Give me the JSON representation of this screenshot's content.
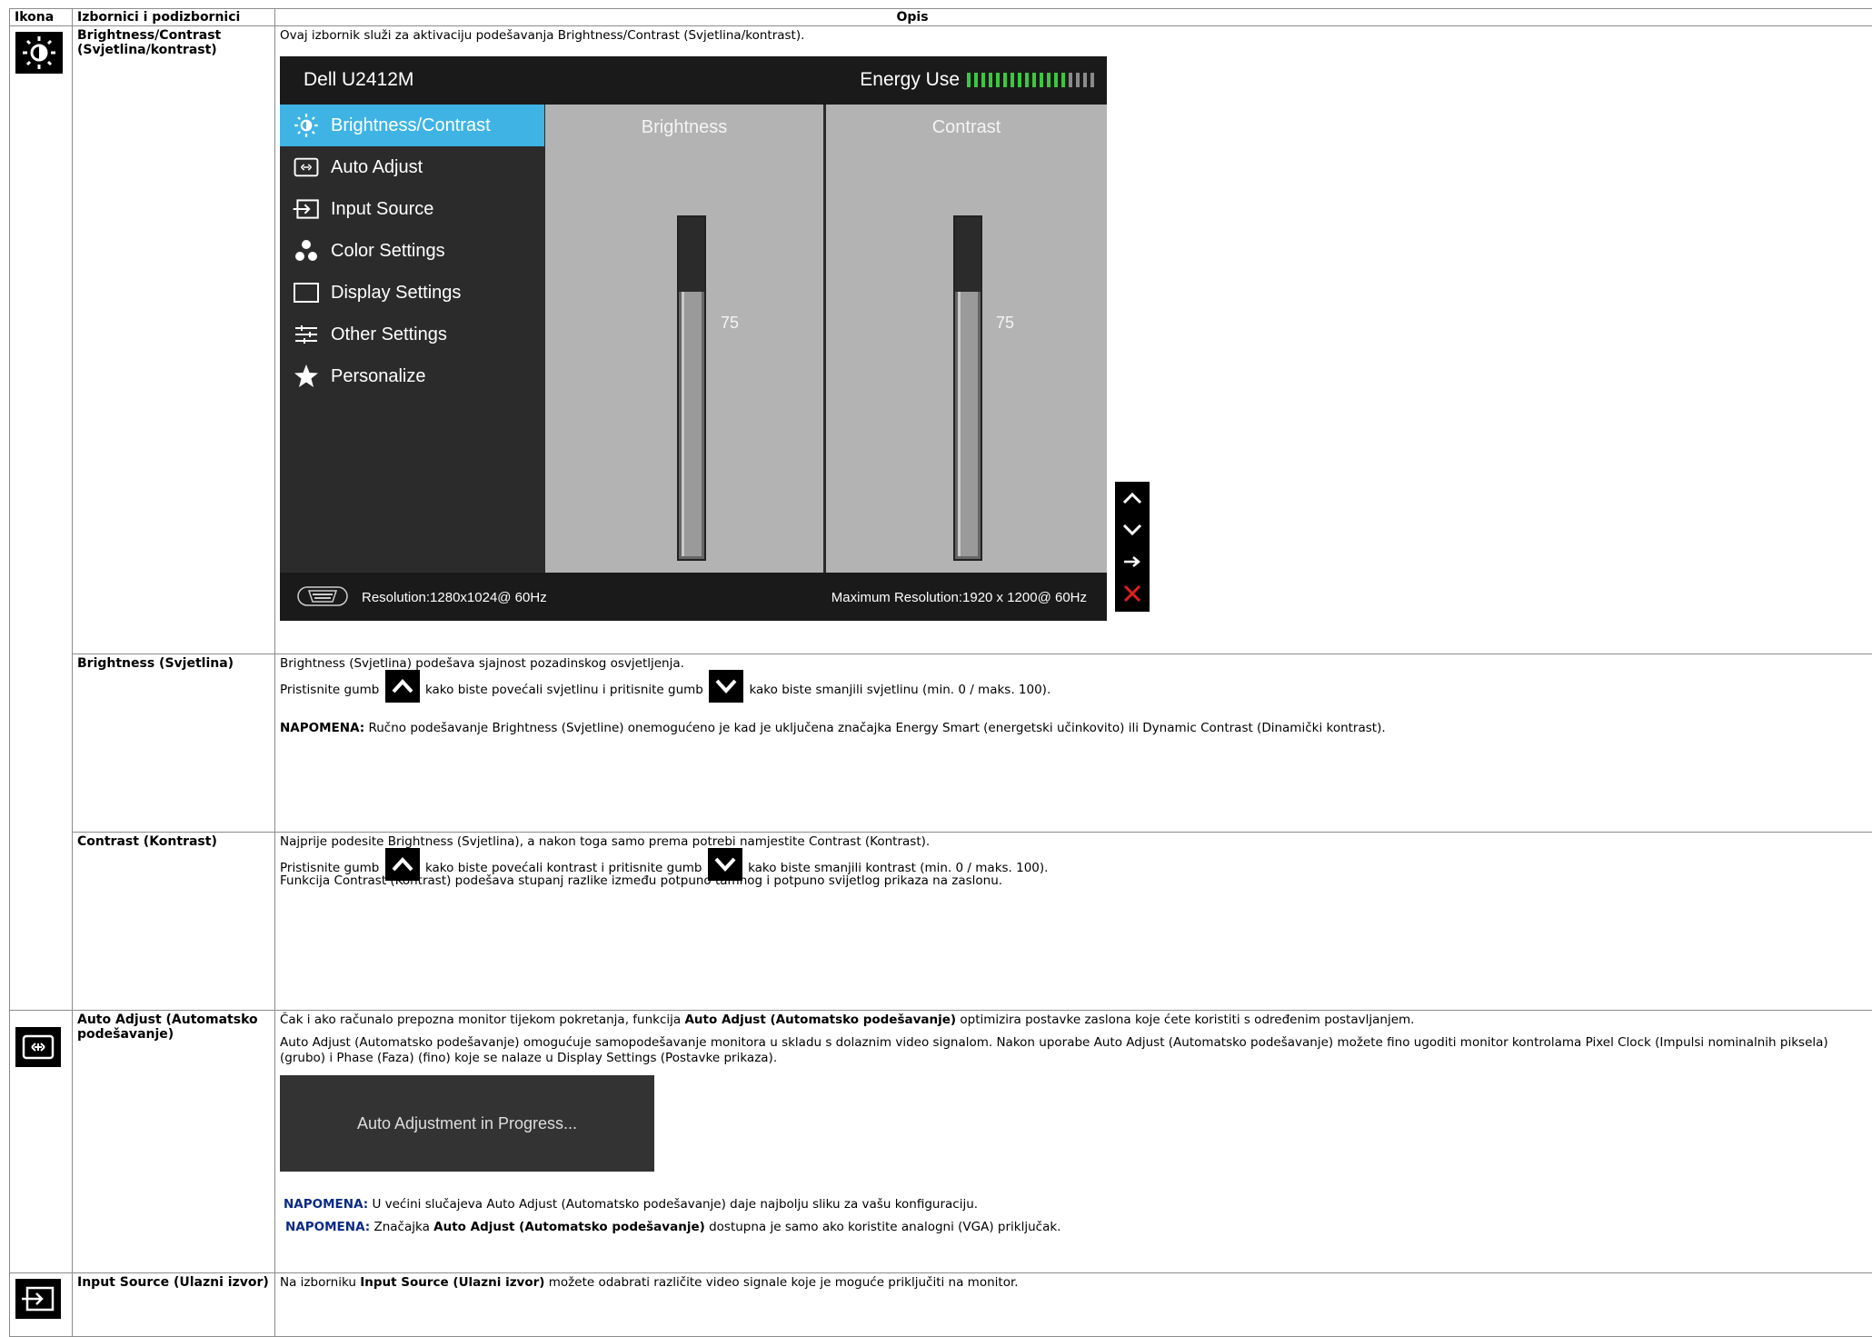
{
  "header": {
    "col_icon": "Ikona",
    "col_menu": "Izbornici i podizbornici",
    "col_desc": "Opis"
  },
  "brightness_contrast": {
    "label": "Brightness/Contrast (Svjetlina/kontrast)",
    "intro": "Ovaj izbornik služi za aktivaciju podešavanja Brightness/Contrast (Svjetlina/kontrast)."
  },
  "osd": {
    "model": "Dell U2412M",
    "energy_label": "Energy Use",
    "energy_level": 0.75,
    "menu": [
      {
        "label": "Brightness/Contrast",
        "icon": "brightness-icon",
        "active": true
      },
      {
        "label": "Auto Adjust",
        "icon": "auto-adjust-icon",
        "active": false
      },
      {
        "label": "Input Source",
        "icon": "input-source-icon",
        "active": false
      },
      {
        "label": "Color Settings",
        "icon": "color-settings-icon",
        "active": false
      },
      {
        "label": "Display Settings",
        "icon": "display-settings-icon",
        "active": false
      },
      {
        "label": "Other Settings",
        "icon": "other-settings-icon",
        "active": false
      },
      {
        "label": "Personalize",
        "icon": "star-icon",
        "active": false
      }
    ],
    "brightness_label": "Brightness",
    "brightness_value": "75",
    "contrast_label": "Contrast",
    "contrast_value": "75",
    "resolution": "Resolution:1280x1024@ 60Hz",
    "max_resolution": "Maximum Resolution:1920 x 1200@ 60Hz",
    "colors": {
      "active": "#3fb4e4",
      "energy_on": "#3cc83c",
      "energy_off": "#8a8a8a",
      "close": "#e02020"
    }
  },
  "brightness": {
    "label": "Brightness (Svjetlina)",
    "line1": "Brightness (Svjetlina) podešava sjajnost pozadinskog osvjetljenja.",
    "line2a": "Pristisnite gumb",
    "line2b": "kako biste povećali svjetlinu i pritisnite gumb",
    "line2c": "kako biste smanjili svjetlinu (min. 0 / maks. 100).",
    "note_label": "NAPOMENA:",
    "note": "Ručno podešavanje Brightness (Svjetline) onemogućeno je kad je uključena značajka Energy Smart (energetski učinkovito) ili Dynamic Contrast (Dinamički kontrast)."
  },
  "contrast": {
    "label": "Contrast (Kontrast)",
    "line1": "Najprije podesite Brightness (Svjetlina), a nakon toga samo prema potrebi namjestite Contrast (Kontrast).",
    "line2a": "Pristisnite gumb",
    "line2b": "kako biste povećali kontrast i pritisnite gumb",
    "line2c": "kako biste smanjili kontrast (min. 0 / maks. 100).",
    "line3": "Funkcija Contrast (Kontrast) podešava stupanj razlike između potpuno tamnog i potpuno svijetlog prikaza na zaslonu."
  },
  "auto_adjust": {
    "label": "Auto Adjust (Automatsko podešavanje)",
    "p1a": "Čak i ako računalo prepozna monitor tijekom pokretanja, funkcija",
    "p1b": "Auto Adjust (Automatsko podešavanje)",
    "p1c": "optimizira postavke zaslona koje ćete koristiti s određenim postavljanjem.",
    "p2": "Auto Adjust (Automatsko podešavanje) omogućuje samopodešavanje monitora u skladu s dolaznim video signalom. Nakon uporabe Auto Adjust (Automatsko podešavanje) možete fino ugoditi monitor kontrolama Pixel Clock (Impulsi nominalnih piksela) (grubo) i Phase (Faza) (fino) koje se nalaze u Display Settings (Postavke prikaza).",
    "progress": "Auto Adjustment  in Progress...",
    "note_label": "NAPOMENA:",
    "note1": "U većini slučajeva Auto Adjust (Automatsko podešavanje) daje najbolju sliku za vašu konfiguraciju.",
    "note2a": "Značajka",
    "note2b": "Auto Adjust (Automatsko podešavanje)",
    "note2c": "dostupna je samo ako koristite analogni (VGA) priključak."
  },
  "input_source": {
    "label": "Input Source (Ulazni izvor)",
    "p1a": "Na izborniku",
    "p1b": "Input Source (Ulazni izvor)",
    "p1c": "možete odabrati različite video signale koje je moguće priključiti na monitor."
  }
}
